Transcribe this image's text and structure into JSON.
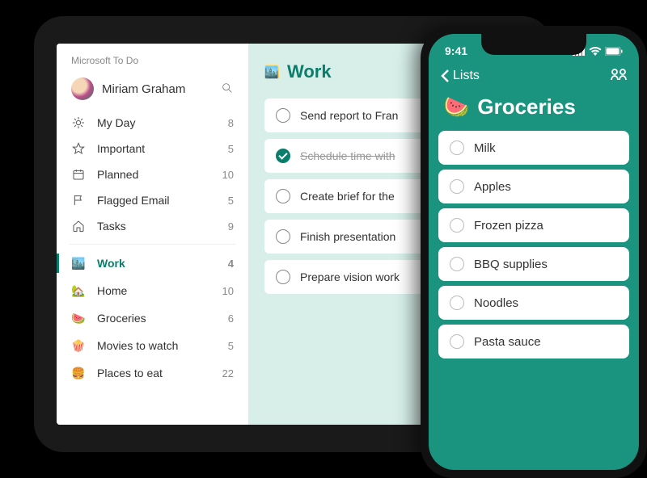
{
  "tablet": {
    "app_name": "Microsoft To Do",
    "user_name": "Miriam Graham",
    "nav": [
      {
        "icon": "sun",
        "label": "My Day",
        "count": 8
      },
      {
        "icon": "star",
        "label": "Important",
        "count": 5
      },
      {
        "icon": "calendar",
        "label": "Planned",
        "count": 10
      },
      {
        "icon": "flag",
        "label": "Flagged Email",
        "count": 5
      },
      {
        "icon": "home",
        "label": "Tasks",
        "count": 9
      }
    ],
    "lists": [
      {
        "emoji": "🏙️",
        "label": "Work",
        "count": 4,
        "active": true
      },
      {
        "emoji": "🏡",
        "label": "Home",
        "count": 10,
        "active": false
      },
      {
        "emoji": "🍉",
        "label": "Groceries",
        "count": 6,
        "active": false
      },
      {
        "emoji": "🍿",
        "label": "Movies to watch",
        "count": 5,
        "active": false
      },
      {
        "emoji": "🍔",
        "label": "Places to eat",
        "count": 22,
        "active": false
      }
    ],
    "work": {
      "title": "Work",
      "title_emoji": "🏙️",
      "tasks": [
        {
          "label": "Send report to Fran",
          "done": false
        },
        {
          "label": "Schedule time with",
          "done": true
        },
        {
          "label": "Create brief for the",
          "done": false
        },
        {
          "label": "Finish presentation",
          "done": false
        },
        {
          "label": "Prepare vision work",
          "done": false
        }
      ]
    }
  },
  "phone": {
    "time": "9:41",
    "back_label": "Lists",
    "title": "Groceries",
    "title_emoji": "🍉",
    "items": [
      {
        "label": "Milk"
      },
      {
        "label": "Apples"
      },
      {
        "label": "Frozen pizza"
      },
      {
        "label": "BBQ supplies"
      },
      {
        "label": "Noodles"
      },
      {
        "label": "Pasta sauce"
      }
    ]
  }
}
